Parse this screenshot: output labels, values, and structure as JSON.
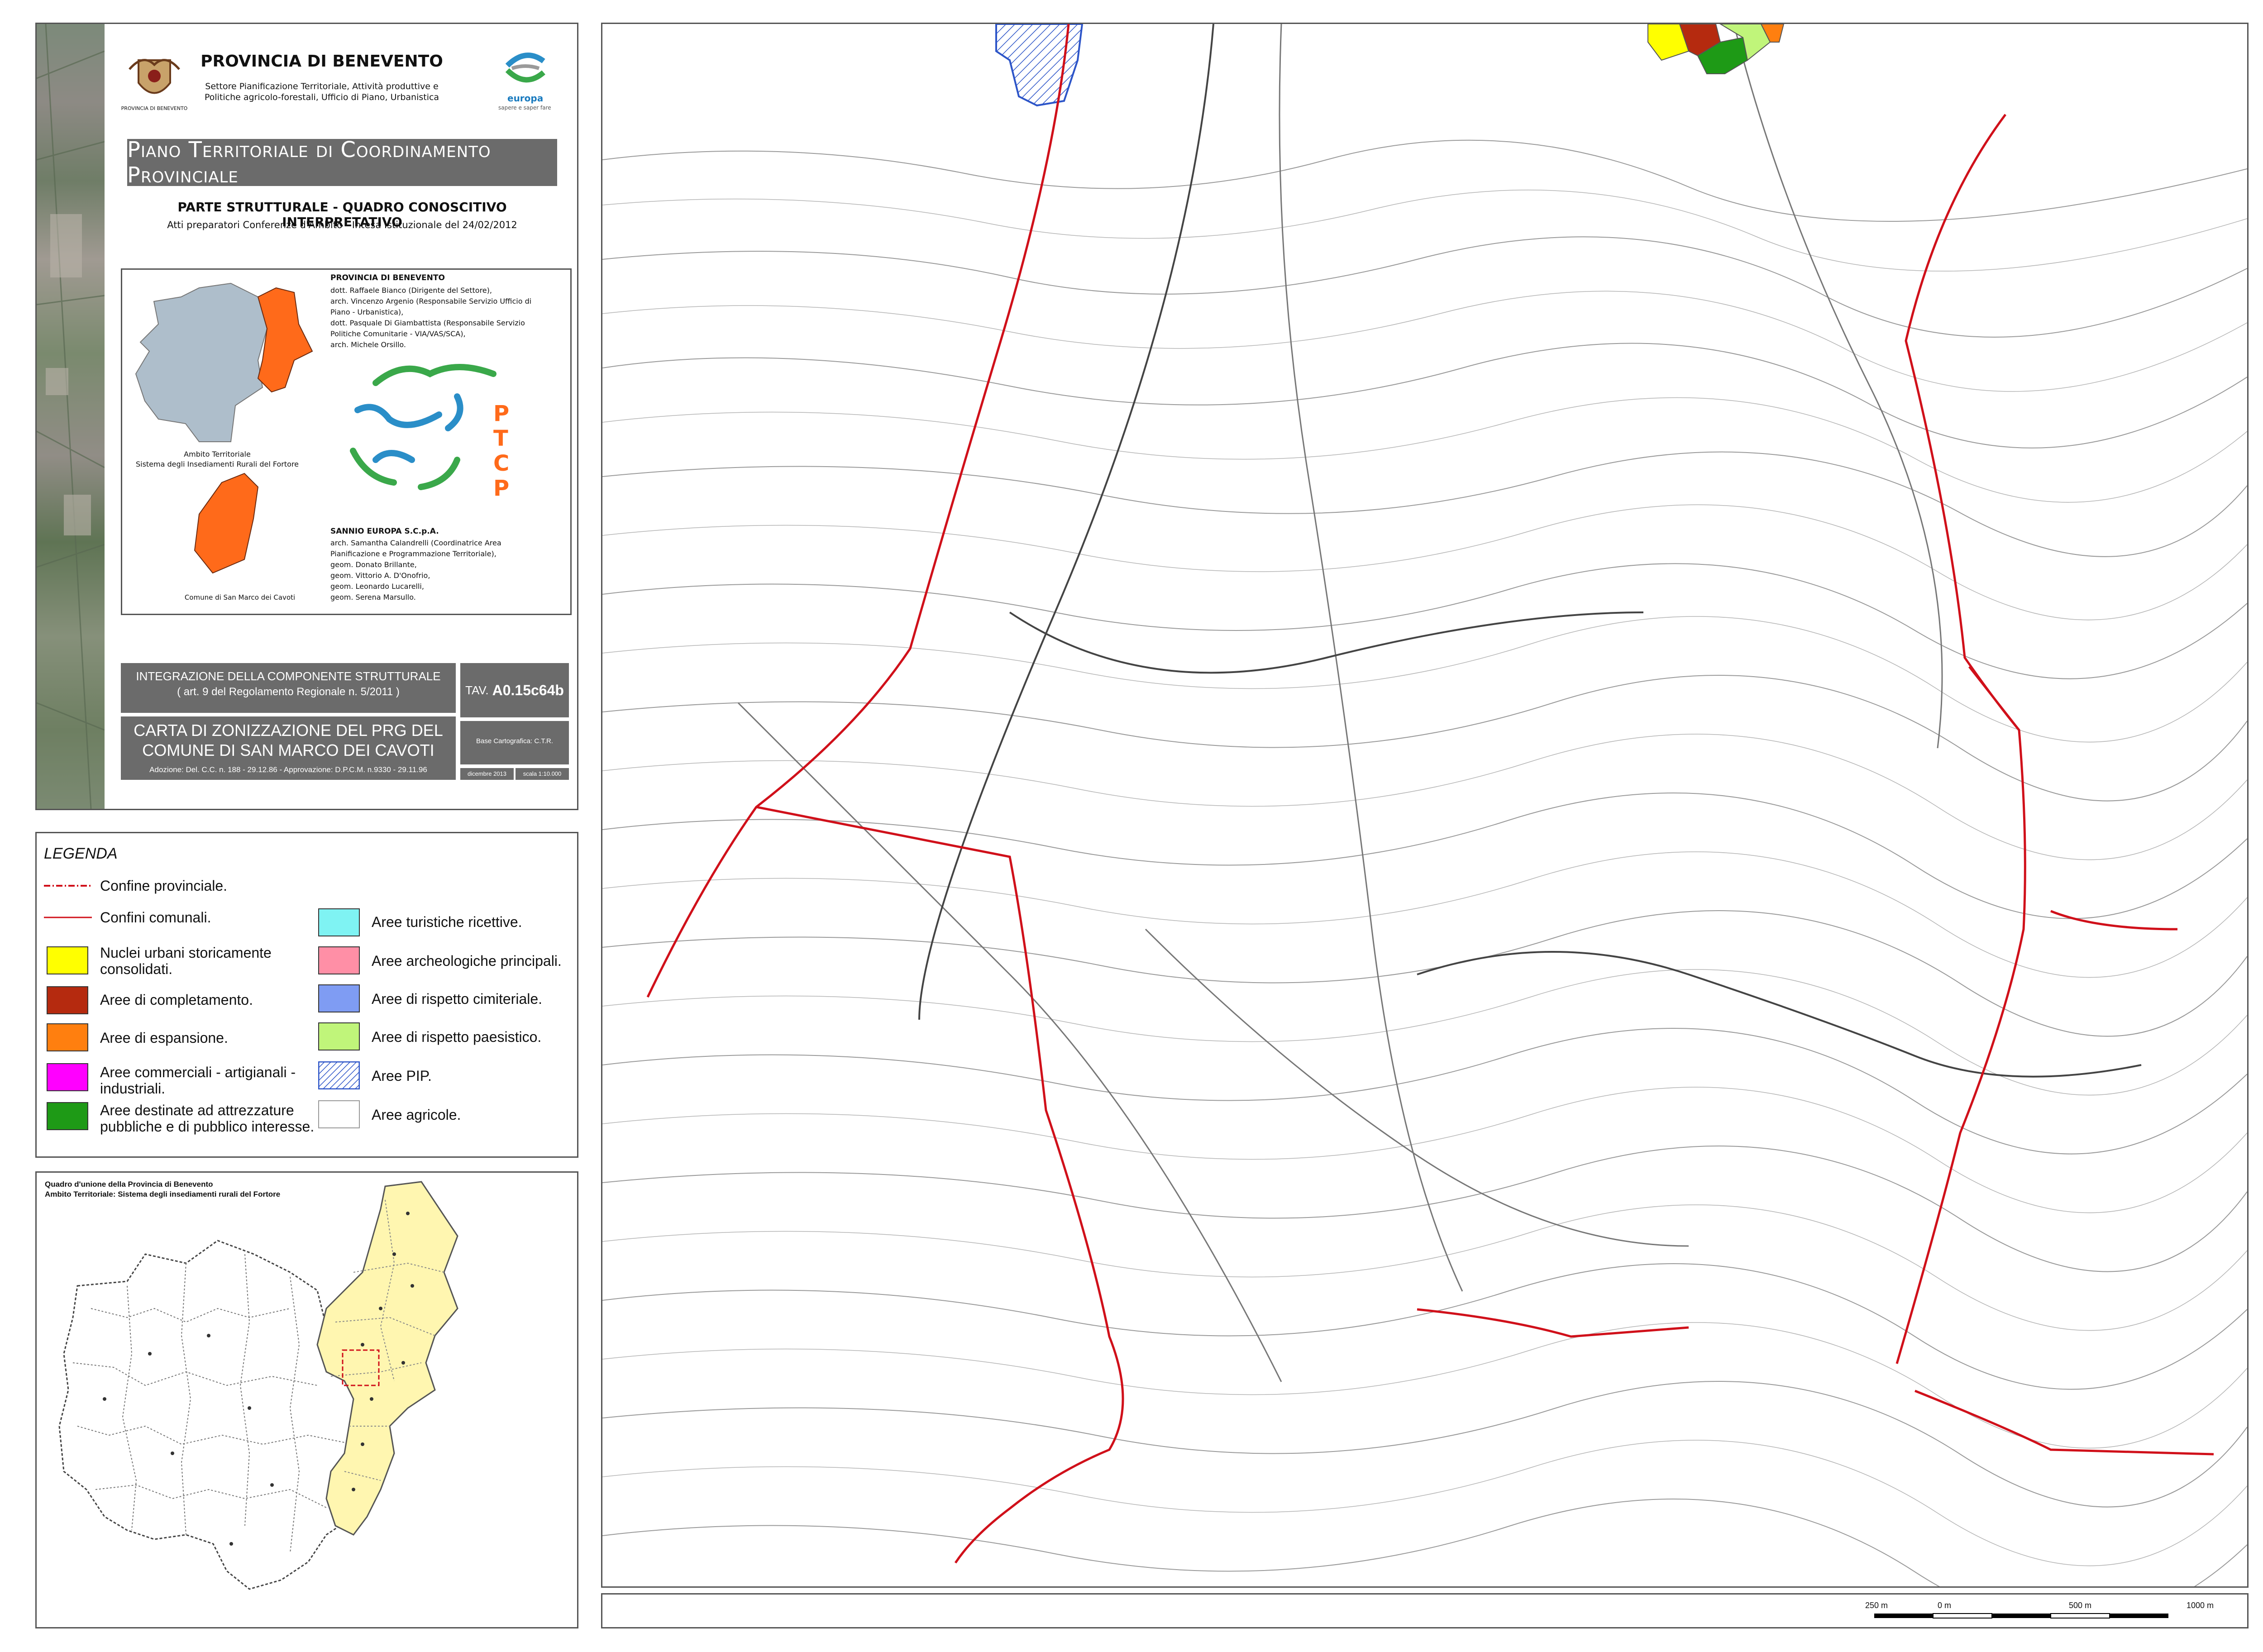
{
  "header": {
    "agency": "PROVINCIA DI BENEVENTO",
    "logo_caption": "PROVINCIA DI BENEVENTO",
    "department": "Settore Pianificazione Territoriale, Attività produttive e Politiche agricolo-forestali, Ufficio di Piano, Urbanistica",
    "partner_logo_text": "europa",
    "partner_logo_tagline": "sapere e saper fare",
    "plan_title": "Piano Territoriale di Coordinamento Provinciale",
    "section": "PARTE STRUTTURALE - QUADRO CONOSCITIVO INTERPRETATIVO",
    "acts": "Atti preparatori Conferenze d'Ambito - Intesa Istituzionale del 24/02/2012"
  },
  "credits": {
    "prov_heading": "PROVINCIA DI BENEVENTO",
    "prov_lines": [
      "dott. Raffaele Bianco (Dirigente del Settore),",
      "arch. Vincenzo Argenio (Responsabile Servizio Ufficio di",
      "Piano - Urbanistica),",
      "dott. Pasquale Di Giambattista (Responsabile Servizio",
      "Politiche Comunitarie - VIA/VAS/SCA),",
      "arch. Michele Orsillo."
    ],
    "sannio_heading": "SANNIO EUROPA S.C.p.A.",
    "sannio_lines": [
      "arch. Samantha Calandrelli (Coordinatrice Area",
      "Pianificazione e Programmazione Territoriale),",
      "geom. Donato Brillante,",
      "geom. Vittorio A. D'Onofrio,",
      "geom. Leonardo Lucarelli,",
      "geom. Serena Marsullo."
    ],
    "ptcp_letters": [
      "P",
      "T",
      "C",
      "P"
    ],
    "ambito_label_1": "Ambito Territoriale",
    "ambito_label_2": "Sistema degli Insediamenti Rurali del Fortore",
    "comune_label": "Comune di San Marco dei Cavoti"
  },
  "sheet": {
    "integration_1": "INTEGRAZIONE DELLA COMPONENTE STRUTTURALE",
    "integration_2": "( art. 9 del Regolamento Regionale n. 5/2011 )",
    "map_title_1": "CARTA DI ZONIZZAZIONE DEL PRG DEL",
    "map_title_2": "COMUNE DI SAN MARCO DEI CAVOTI",
    "adoption": "Adozione: Del. C.C. n. 188 - 29.12.86 - Approvazione: D.P.C.M. n.9330 - 29.11.96",
    "tav_prefix": "TAV.",
    "tav_code": "A0.15c64b",
    "base": "Base Cartografica: C.T.R.",
    "date": "dicembre 2013",
    "scale": "scala 1:10.000"
  },
  "legend": {
    "title": "LEGENDA",
    "items": [
      {
        "label": "Confine provinciale.",
        "color": "#d0101a",
        "kind": "line-dashed"
      },
      {
        "label": "Confini comunali.",
        "color": "#d0101a",
        "kind": "line"
      },
      {
        "label": "Nuclei urbani storicamente consolidati.",
        "color": "#ffff00",
        "kind": "fill"
      },
      {
        "label": "Aree di completamento.",
        "color": "#b52a0f",
        "kind": "fill"
      },
      {
        "label": "Aree di espansione.",
        "color": "#ff7f0f",
        "kind": "fill"
      },
      {
        "label": "Aree commerciali - artigianali - industriali.",
        "color": "#ff00ff",
        "kind": "fill"
      },
      {
        "label": "Aree destinate ad attrezzature pubbliche e di pubblico interesse.",
        "color": "#1e9a16",
        "kind": "fill"
      },
      {
        "label": "Aree turistiche ricettive.",
        "color": "#7ff3f3",
        "kind": "fill"
      },
      {
        "label": "Aree archeologiche principali.",
        "color": "#ff8fa6",
        "kind": "fill"
      },
      {
        "label": "Aree di rispetto cimiteriale.",
        "color": "#7f9cf3",
        "kind": "fill"
      },
      {
        "label": "Aree di rispetto paesistico.",
        "color": "#c0f57a",
        "kind": "fill"
      },
      {
        "label": "Aree PIP.",
        "color": "#2d55c8",
        "kind": "hatch"
      },
      {
        "label": "Aree agricole.",
        "color": "#ffffff",
        "kind": "fill"
      }
    ]
  },
  "index_map": {
    "title_1": "Quadro d'unione della Provincia di Benevento",
    "title_2": "Ambito Territoriale: Sistema degli insediamenti rurali del Fortore"
  },
  "scale_bar": {
    "labels": [
      "250 m",
      "0 m",
      "500 m",
      "1000 m"
    ]
  }
}
